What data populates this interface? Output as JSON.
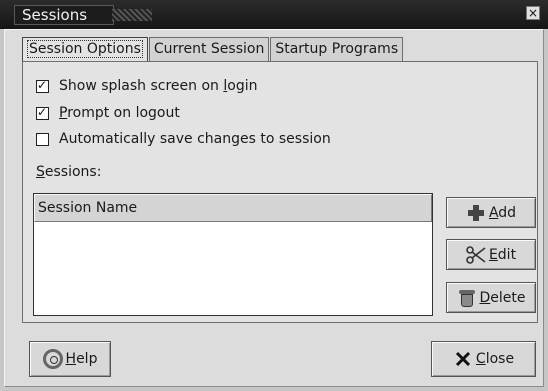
{
  "window": {
    "title": "Sessions",
    "close_glyph": "×"
  },
  "tabs": [
    {
      "label": "Session Options",
      "active": true
    },
    {
      "label": "Current Session",
      "active": false
    },
    {
      "label": "Startup Programs",
      "active": false
    }
  ],
  "options": {
    "splash": {
      "label_pre": "Show splash screen on ",
      "label_u": "l",
      "label_post": "ogin",
      "checked": true
    },
    "prompt": {
      "label_pre": "",
      "label_u": "P",
      "label_post": "rompt on logout",
      "checked": true
    },
    "autosave": {
      "label": "Automatically save changes to session",
      "checked": false
    }
  },
  "sessions": {
    "label_u": "S",
    "label_post": "essions:",
    "column_header": "Session Name",
    "rows": []
  },
  "buttons": {
    "add": {
      "u": "A",
      "rest": "dd",
      "icon": "plus-icon"
    },
    "edit": {
      "u": "E",
      "rest": "dit",
      "icon": "scissors-icon"
    },
    "delete": {
      "u": "D",
      "rest": "elete",
      "icon": "trash-icon"
    },
    "help": {
      "u": "H",
      "rest": "elp",
      "icon": "help-icon"
    },
    "close": {
      "u": "C",
      "rest": "lose",
      "icon": "close-icon"
    }
  },
  "check_glyph": "✓"
}
